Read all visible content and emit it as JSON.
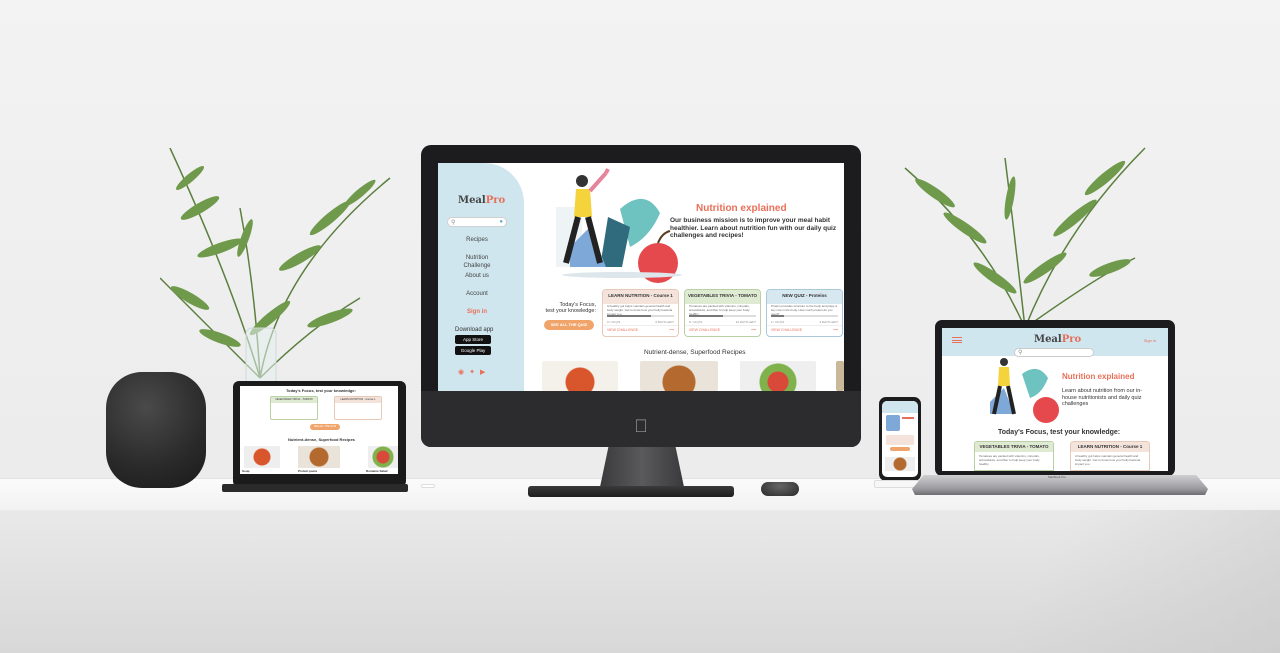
{
  "brand": {
    "name_a": "Meal",
    "name_b": "Pro"
  },
  "colors": {
    "accent": "#e8705a",
    "sidebar": "#cfe6ee",
    "card_green": "#dfead2",
    "card_blue": "#d8e8f0",
    "card_peach": "#f4e3da",
    "button": "#f0a46a"
  },
  "desktop": {
    "nav": [
      "Recipes",
      "Nutrition\nChallenge",
      "About us",
      "Account"
    ],
    "sign_in": "Sign in",
    "download_label": "Download app",
    "app_store": "App Store",
    "google_play": "Google Play",
    "hero": {
      "title": "Nutrition explained",
      "text": "Our business mission is to improve your meal habit healthier. Learn about nutrition fun with our daily quiz challenges and recipes!"
    },
    "focus_label": "Today's Focus,\ntest your knowledge:",
    "quiz_button": "SEE ALL THE QUIZ",
    "cards": [
      {
        "title": "LEARN NUTRITION - Course 1",
        "desc": "A healthy gut helps maintain general health and body weight. Get to know how your belly bacteria impact you.",
        "progress": 0.65,
        "meta_left": "3 / 10 Q'S",
        "meta_right": "6 DAYS LEFT",
        "link": "VIEW CHALLENGE"
      },
      {
        "title": "VEGETABLES TRIVIA - TOMATO",
        "desc": "Tomatoes are packed with vitamins, minerals, antioxidants, and fiber to help keep your body healthy.",
        "progress": 0.5,
        "meta_left": "5 / 10 Q'S",
        "meta_right": "12 DAYS LEFT",
        "link": "VIEW CHALLENGE"
      },
      {
        "title": "NEW QUIZ - Proteins",
        "desc": "Protein provides structure to the body and plays a key role in the body. How much protein do you need?",
        "progress": 0.2,
        "meta_left": "1 / 10 Q'S",
        "meta_right": "4 DAYS LEFT",
        "link": "VIEW CHALLENGE"
      }
    ],
    "recipes_title": "Nutrient-dense, Superfood Recipes"
  },
  "tablet": {
    "focus_label": "Today's Focus, test your knowledge:",
    "quiz_button": "SEE ALL THE QUIZ",
    "cards": [
      {
        "title": "VEGETABLES TRIVIA - TOMATO"
      },
      {
        "title": "LEARN NUTRITION - Course 1"
      }
    ],
    "recipes_title": "Nutrient-dense, Superfood Recipes",
    "recipe_names": [
      "Soup",
      "Protein pasta",
      "Romaine Salad"
    ]
  },
  "laptop": {
    "sign_in": "Sign in",
    "hero_title": "Nutrition explained",
    "hero_text": "Learn about nutrition from our in-house nutritionists and daily quiz challenges",
    "focus_label": "Today's Focus, test your knowledge:",
    "cards": [
      {
        "title": "VEGETABLES TRIVIA - TOMATO",
        "desc": "Tomatoes are packed with vitamins, minerals, antioxidants, and fiber to help keep your body healthy."
      },
      {
        "title": "LEARN NUTRITION - Course 1",
        "desc": "A healthy gut helps maintain general health and body weight. Get to know how your belly bacteria impact you."
      }
    ],
    "base_brand": "MacBook Pro"
  }
}
